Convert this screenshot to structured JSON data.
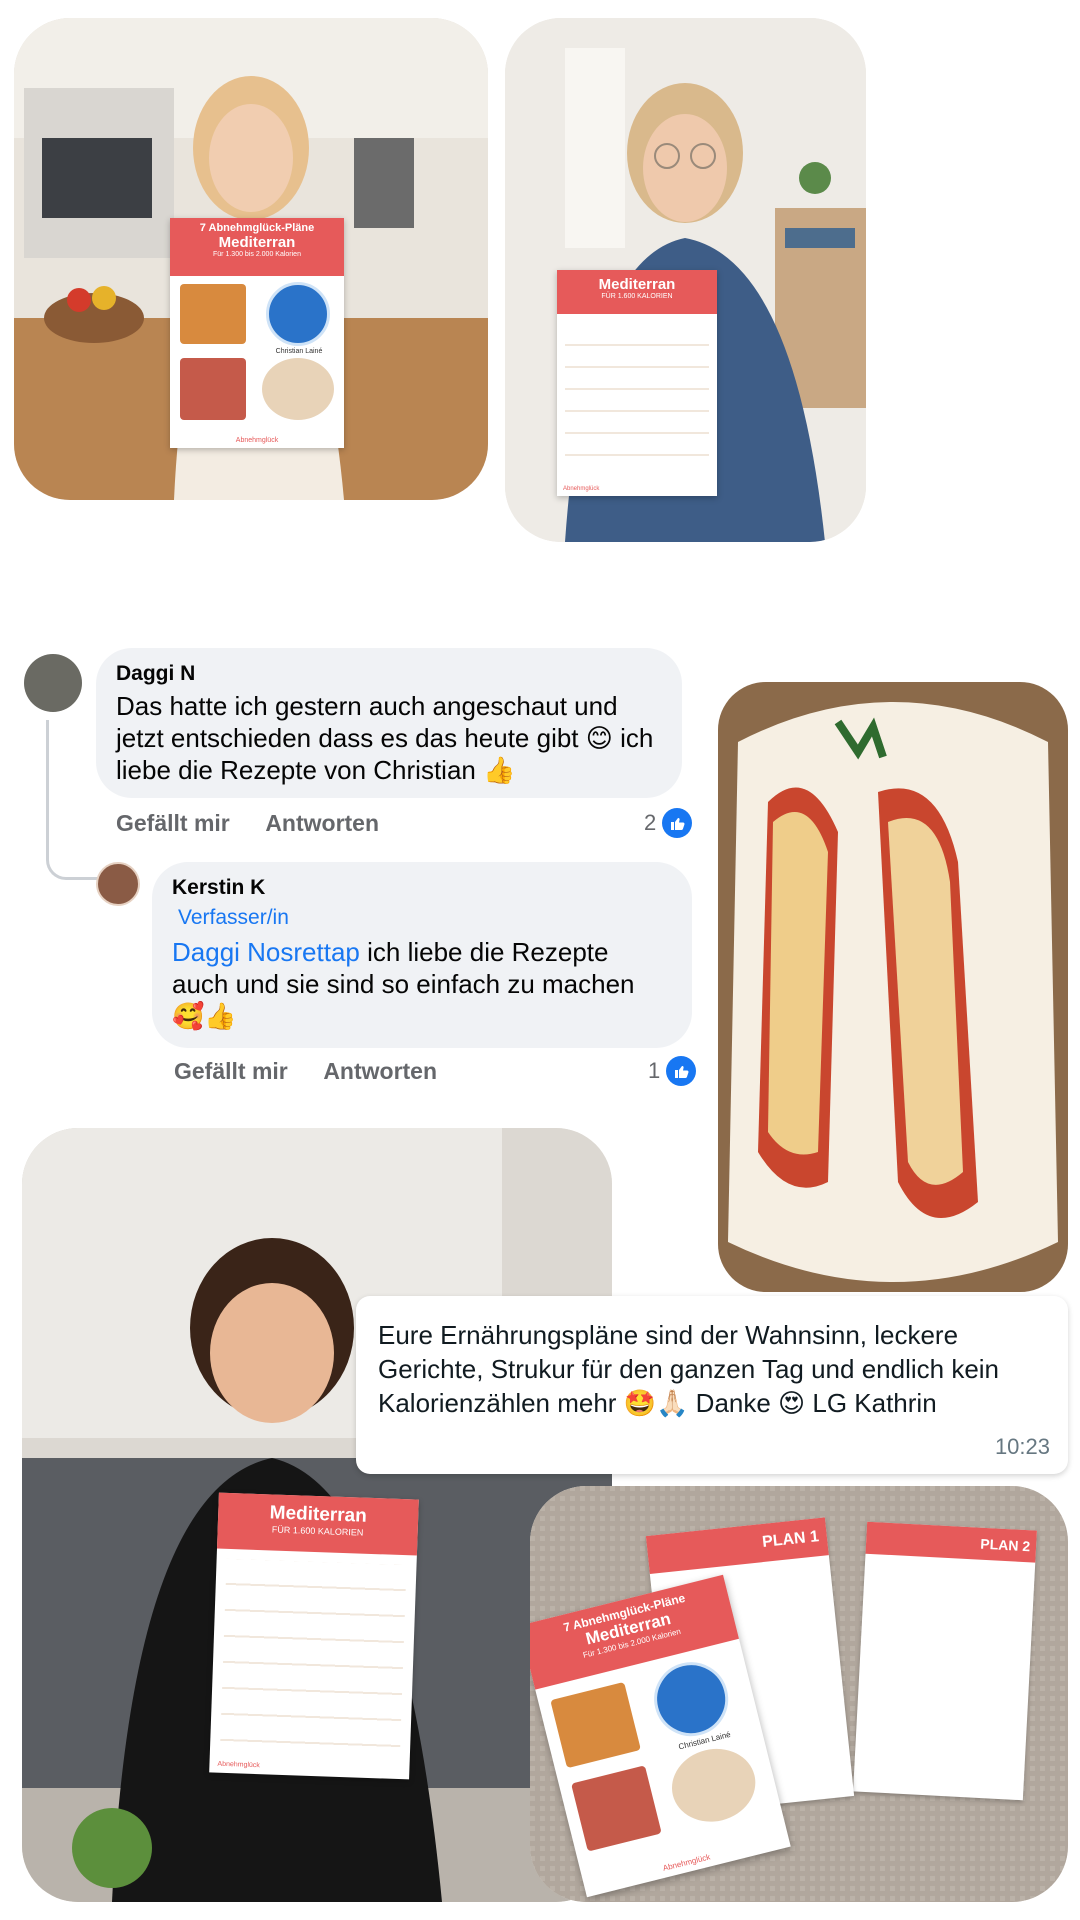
{
  "photos": {
    "top_left": {
      "sheet_title": "7 Abnehmglück-Pläne",
      "sheet_title2": "Mediterran",
      "sheet_subtitle": "Für 1.300 bis 2.000 Kalorien",
      "author": "Christian Lainé",
      "brand": "Abnehmglück"
    },
    "top_right": {
      "sheet_title": "Mediterran",
      "sheet_subtitle": "FÜR 1.600 KALORIEN",
      "brand": "Abnehmglück"
    },
    "bottom_left": {
      "sheet_title": "Mediterran",
      "sheet_subtitle": "FÜR 1.600 KALORIEN",
      "brand": "Abnehmglück"
    },
    "bottom_right": {
      "sheet_title": "7 Abnehmglück-Pläne",
      "sheet_title2": "Mediterran",
      "sheet_subtitle": "Für 1.300 bis 2.000 Kalorien",
      "author": "Christian Lainé",
      "plan1": "PLAN 1",
      "plan2": "PLAN 2",
      "brand": "Abnehmglück"
    }
  },
  "comments": [
    {
      "name": "Daggi N",
      "text": "Das hatte ich gestern auch angeschaut und jetzt entschieden dass es das heute gibt 😊 ich liebe die Rezepte von Christian 👍",
      "like_label": "Gefällt mir",
      "reply_label": "Antworten",
      "likes": "2"
    },
    {
      "name": "Kerstin K",
      "badge": "Verfasser/in",
      "mention": "Daggi Nosrettap",
      "text": " ich liebe die Rezepte auch und sie sind so einfach zu machen",
      "emojis": "🥰👍",
      "like_label": "Gefällt mir",
      "reply_label": "Antworten",
      "likes": "1"
    }
  ],
  "message": {
    "text": "Eure Ernährungspläne sind der Wahnsinn, leckere Gerichte, Strukur für den ganzen Tag und endlich kein Kalorienzählen mehr 🤩🙏🏻 Danke 😍 LG Kathrin",
    "time": "10:23"
  },
  "colors": {
    "accent_red": "#e65a5a",
    "fb_blue": "#1877f2",
    "bubble_gray": "#f0f2f5"
  }
}
